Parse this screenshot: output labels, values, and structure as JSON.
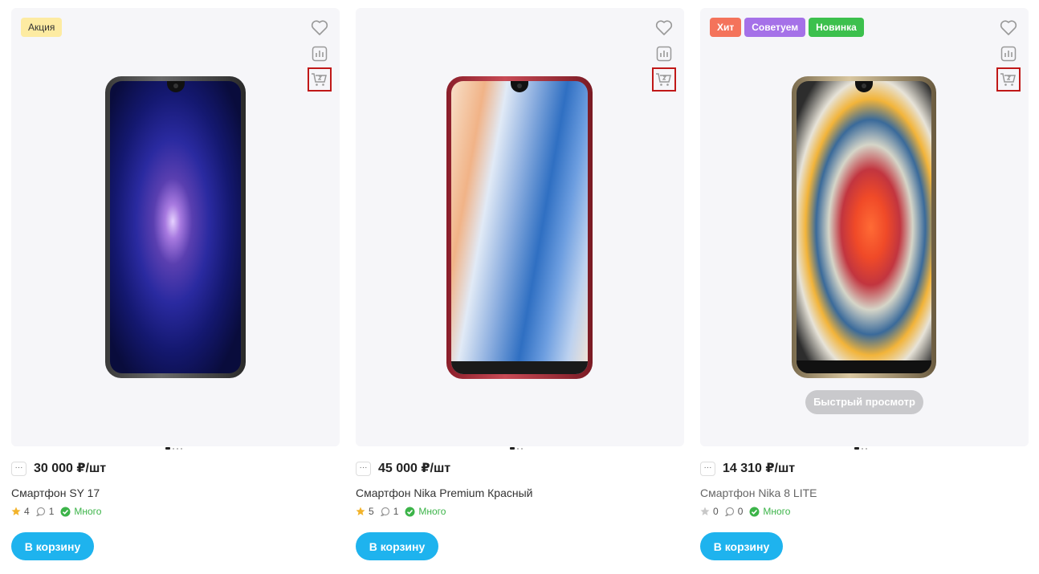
{
  "colors": {
    "accent": "#1eb3ee",
    "stock": "#3cb449",
    "badge_sale": "#fdeba2",
    "badge_hit": "#f4735b",
    "badge_advise": "#a571e8",
    "badge_new": "#3cc04d"
  },
  "products": [
    {
      "badges": [
        "Акция"
      ],
      "price": "30 000 ₽/шт",
      "name": "Смартфон SY 17",
      "rating": "4",
      "reviews": "1",
      "stock": "Много",
      "buy_label": "В корзину",
      "icons": [
        "heart-icon",
        "compare-icon",
        "cart-icon"
      ]
    },
    {
      "badges": [],
      "price": "45 000 ₽/шт",
      "name": "Смартфон Nika Premium Красный",
      "rating": "5",
      "reviews": "1",
      "stock": "Много",
      "buy_label": "В корзину",
      "icons": [
        "heart-icon",
        "compare-icon",
        "cart-icon"
      ]
    },
    {
      "badges": [
        "Хит",
        "Советуем",
        "Новинка"
      ],
      "price": "14 310 ₽/шт",
      "name": "Смартфон Nika 8 LITE",
      "rating": "0",
      "reviews": "0",
      "stock": "Много",
      "buy_label": "В корзину",
      "quick_view": "Быстрый просмотр",
      "icons": [
        "heart-icon",
        "compare-icon",
        "cart-icon"
      ]
    }
  ],
  "more_glyph": "···"
}
